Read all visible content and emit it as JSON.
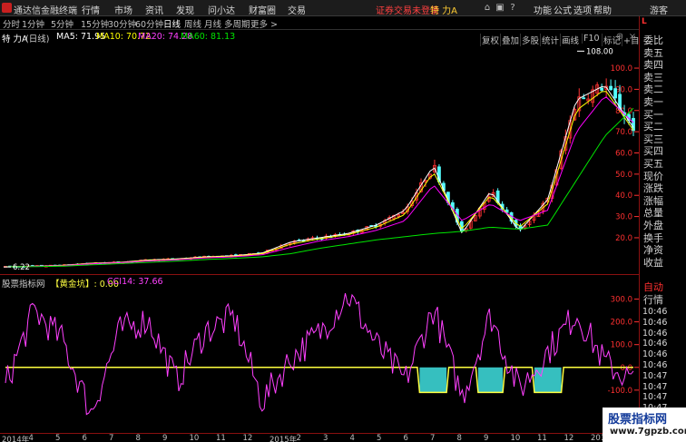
{
  "app": {
    "title": "通达信金融终端"
  },
  "menu": [
    "行情",
    "市场",
    "资讯",
    "发现",
    "问小达",
    "财富圈",
    "交易"
  ],
  "notice": "证券交易未登录",
  "notice_stock": "特 力A",
  "user": "游客",
  "periods": [
    {
      "label": "分时",
      "active": false
    },
    {
      "label": "1分钟",
      "active": false
    },
    {
      "label": "5分钟",
      "active": false
    },
    {
      "label": "15分钟",
      "active": false
    },
    {
      "label": "30分钟",
      "active": false
    },
    {
      "label": "60分钟",
      "active": false
    },
    {
      "label": "日线",
      "active": true
    },
    {
      "label": "周线",
      "active": false
    },
    {
      "label": "月线",
      "active": false
    },
    {
      "label": "多周期",
      "active": false
    },
    {
      "label": "更多 >",
      "active": false
    }
  ],
  "toolbar": [
    "复权",
    "叠加",
    "多股",
    "统计",
    "画线",
    "F10",
    "标记",
    "+自选",
    "返回"
  ],
  "main_legend": {
    "stock": "特 力A",
    "period": "(日线)",
    "ma5": "MA5: 71.95",
    "ma10": "MA10: 70.72",
    "ma20": "MA20: 74.28",
    "ma60": "MA60: 81.13"
  },
  "indicator_legend": {
    "site": "股票指标网",
    "name": "【黄金坑】: 0.00",
    "cci": "CCI14: 37.66"
  },
  "colors": {
    "up": "#ff3232",
    "down": "#54fcfc",
    "ma5": "#ffffff",
    "ma10": "#ffff00",
    "ma20": "#ff00ff",
    "ma60": "#00e600",
    "cci": "#ff40ff",
    "fill": "#40e0e0",
    "zero_line": "#ffff40",
    "axis": "#ff3030"
  },
  "chart_data": [
    {
      "type": "candlestick",
      "title": "特 力A (日线)",
      "yaxis_ticks": [
        20.0,
        30.0,
        40.0,
        50.0,
        60.0,
        70.0,
        80.0,
        90.0,
        100.0
      ],
      "ylim": [
        5.0,
        112.0
      ],
      "annotations": [
        {
          "label": "108.00",
          "value": 108.0,
          "kind": "high"
        },
        {
          "label": "6.22",
          "value": 6.22,
          "kind": "low"
        }
      ],
      "x": [
        "2014-01",
        "2014-04",
        "2014-05",
        "2014-06",
        "2014-07",
        "2014-08",
        "2014-09",
        "2014-10",
        "2014-11",
        "2014-12",
        "2015-01",
        "2015-02",
        "2015-03",
        "2015-04",
        "2015-05",
        "2015-06",
        "2015-07",
        "2015-08",
        "2015-09",
        "2015-10",
        "2015-11",
        "2015-12",
        "2016-01"
      ],
      "series": [
        {
          "name": "MA5",
          "values": [
            6.3,
            6.6,
            7.0,
            8.0,
            8.4,
            9.5,
            10.0,
            11.0,
            11.5,
            12.8,
            18.0,
            20.0,
            22.0,
            26.0,
            33.0,
            54.0,
            22.0,
            42.0,
            23.0,
            38.0,
            85.0,
            92.0,
            72.0
          ]
        },
        {
          "name": "MA10",
          "values": [
            6.3,
            6.5,
            6.9,
            7.9,
            8.3,
            9.3,
            9.8,
            10.8,
            11.3,
            12.5,
            17.0,
            19.5,
            21.5,
            25.0,
            31.0,
            51.0,
            24.0,
            40.0,
            25.0,
            36.0,
            80.0,
            90.0,
            70.7
          ]
        },
        {
          "name": "MA20",
          "values": [
            6.3,
            6.5,
            6.8,
            7.7,
            8.2,
            9.0,
            9.6,
            10.5,
            11.0,
            12.0,
            15.5,
            18.5,
            20.5,
            23.5,
            28.0,
            45.0,
            28.0,
            36.0,
            28.0,
            33.0,
            70.0,
            87.0,
            74.3
          ]
        },
        {
          "name": "MA60",
          "values": [
            6.3,
            6.4,
            6.6,
            7.2,
            7.8,
            8.4,
            9.0,
            9.7,
            10.3,
            11.0,
            12.5,
            15.0,
            17.0,
            19.0,
            20.5,
            22.0,
            23.0,
            25.0,
            24.0,
            26.0,
            47.0,
            68.0,
            81.1
          ]
        }
      ]
    },
    {
      "type": "line",
      "title": "【黄金坑】",
      "yaxis_ticks": [
        -200.0,
        -100.0,
        0.0,
        100.0,
        200.0,
        300.0
      ],
      "ylim": [
        -280.0,
        350.0
      ],
      "x": [
        "2014-01",
        "2014-04",
        "2014-05",
        "2014-06",
        "2014-07",
        "2014-08",
        "2014-09",
        "2014-10",
        "2014-11",
        "2014-12",
        "2015-01",
        "2015-02",
        "2015-03",
        "2015-04",
        "2015-05",
        "2015-06",
        "2015-07",
        "2015-08",
        "2015-09",
        "2015-10",
        "2015-11",
        "2015-12",
        "2016-01"
      ],
      "series": [
        {
          "name": "CCI14",
          "values": [
            -80,
            250,
            120,
            -200,
            160,
            210,
            -60,
            160,
            220,
            -150,
            40,
            150,
            320,
            100,
            -60,
            260,
            -130,
            230,
            -100,
            70,
            240,
            20,
            -60
          ]
        },
        {
          "name": "黄金坑",
          "values": [
            0,
            0,
            0,
            0,
            0,
            0,
            0,
            0,
            0,
            0,
            0,
            0,
            0,
            0,
            0,
            -110,
            0,
            -110,
            0,
            -110,
            0,
            0,
            0
          ]
        }
      ]
    }
  ],
  "xaxis_labels": [
    "2014年",
    "4",
    "5",
    "6",
    "7",
    "8",
    "9",
    "10",
    "11",
    "12",
    "2015年",
    "2",
    "3",
    "4",
    "5",
    "6",
    "7",
    "8",
    "9",
    "10",
    "11",
    "12",
    "2016"
  ],
  "right_panel": {
    "badge": "L",
    "top": [
      "委比",
      "卖五",
      "卖四",
      "卖三",
      "卖二",
      "卖一",
      "买一",
      "买二",
      "买三",
      "买四",
      "买五",
      "现价",
      "涨跌",
      "涨幅",
      "总量",
      "外盘",
      "换手",
      "净资",
      "收益"
    ],
    "auto": "自动",
    "quote": "行情",
    "times": [
      "10:46",
      "10:46",
      "10:46",
      "10:46",
      "10:46",
      "10:46",
      "10:47",
      "10:47",
      "10:47",
      "10:47",
      "10:47"
    ]
  },
  "watermark": {
    "line1": "股票指标网",
    "line2": "www.7gpzb.com"
  }
}
